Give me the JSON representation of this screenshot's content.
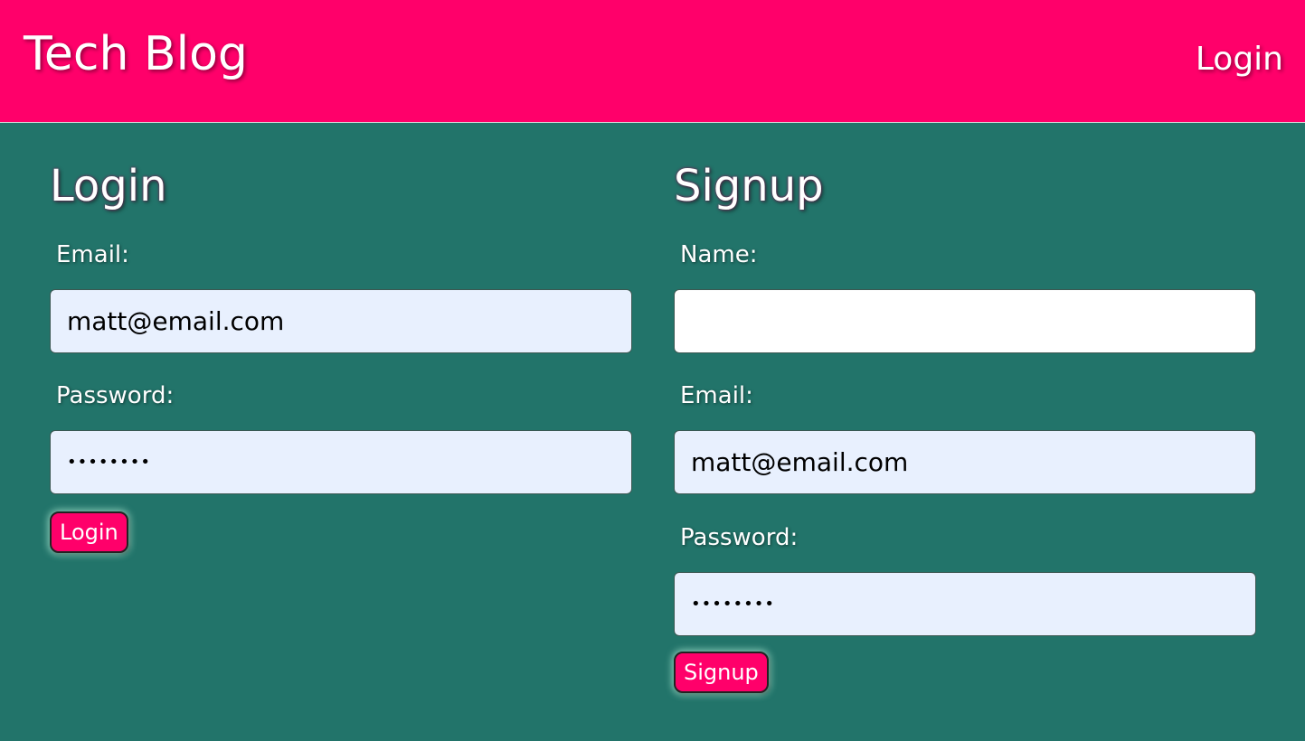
{
  "header": {
    "site_title": "Tech Blog",
    "nav_login_label": "Login"
  },
  "login_form": {
    "title": "Login",
    "email_label": "Email:",
    "email_value": "matt@email.com",
    "password_label": "Password:",
    "password_value": "matt1234",
    "submit_label": "Login"
  },
  "signup_form": {
    "title": "Signup",
    "name_label": "Name:",
    "name_value": "",
    "email_label": "Email:",
    "email_value": "matt@email.com",
    "password_label": "Password:",
    "password_value": "matt1234",
    "submit_label": "Signup"
  },
  "colors": {
    "header_bg": "#ff006a",
    "page_bg": "#22746a",
    "button_bg": "#ff006a",
    "autofill_bg": "#e8f0fe"
  }
}
